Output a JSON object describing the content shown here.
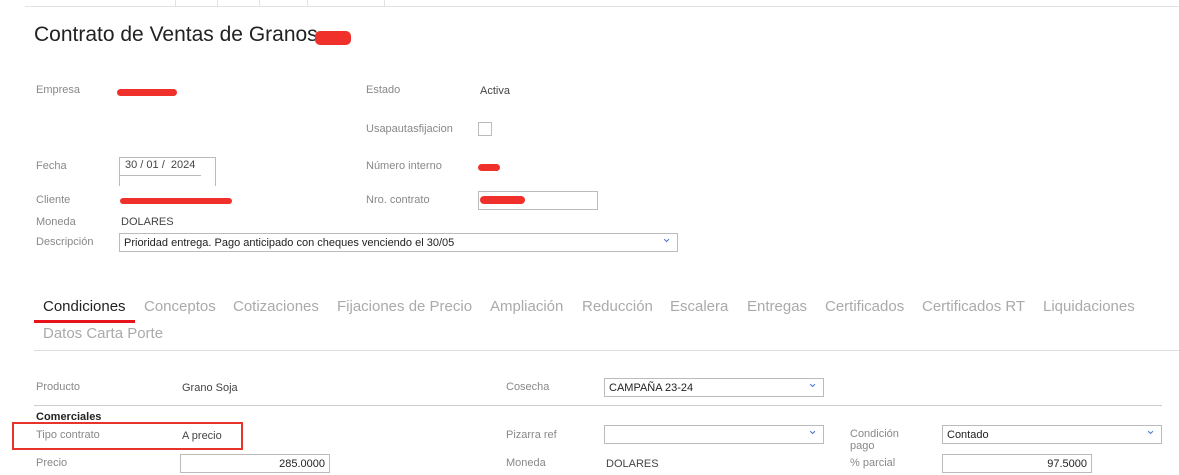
{
  "header": {
    "title": "Contrato de Ventas de Granos - "
  },
  "form": {
    "empresa_label": "Empresa",
    "estado_label": "Estado",
    "estado_value": "Activa",
    "usapautas_label": "Usapautasfijacion",
    "fecha_label": "Fecha",
    "fecha_value": "30 / 01 /  2024",
    "numero_interno_label": "Número interno",
    "cliente_label": "Cliente",
    "nro_contrato_label": "Nro. contrato",
    "moneda_label": "Moneda",
    "moneda_value": "DOLARES",
    "descripcion_label": "Descripción",
    "descripcion_value": "Prioridad entrega. Pago anticipado con cheques venciendo el 30/05"
  },
  "tabs": [
    {
      "label": "Condiciones"
    },
    {
      "label": "Conceptos"
    },
    {
      "label": "Cotizaciones"
    },
    {
      "label": "Fijaciones de Precio"
    },
    {
      "label": "Ampliación"
    },
    {
      "label": "Reducción"
    },
    {
      "label": "Escalera"
    },
    {
      "label": "Entregas"
    },
    {
      "label": "Certificados"
    },
    {
      "label": "Certificados RT"
    },
    {
      "label": "Liquidaciones"
    },
    {
      "label": "Datos Carta Porte"
    }
  ],
  "conditions": {
    "producto_label": "Producto",
    "producto_value": "Grano Soja",
    "cosecha_label": "Cosecha",
    "cosecha_value": "CAMPAÑA 23-24",
    "section_title": "Comerciales",
    "tipo_label": "Tipo contrato",
    "tipo_value": "A precio",
    "pizarra_label": "Pizarra ref",
    "pizarra_value": "",
    "condicion_label": "Condición pago",
    "condicion_value": "Contado",
    "precio_label": "Precio",
    "precio_value": "285.0000",
    "moneda_label": "Moneda",
    "moneda_value": "DOLARES",
    "parcial_label": "% parcial",
    "parcial_value": "97.5000"
  },
  "colors": {
    "accent": "#e8121b",
    "highlight": "#e8332b"
  }
}
